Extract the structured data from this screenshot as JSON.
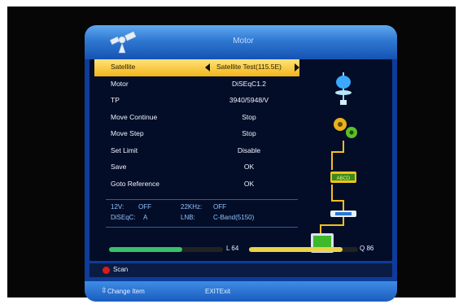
{
  "header": {
    "title": "Motor"
  },
  "menu": {
    "items": [
      {
        "label": "Satellite",
        "value": "Satellite Test(115.5E)",
        "selected": true
      },
      {
        "label": "Motor",
        "value": "DiSEqC1.2"
      },
      {
        "label": "TP",
        "value": "3940/5948/V"
      },
      {
        "label": "Move Continue",
        "value": "Stop"
      },
      {
        "label": "Move Step",
        "value": "Stop"
      },
      {
        "label": "Set Limit",
        "value": "Disable"
      },
      {
        "label": "Save",
        "value": "OK"
      },
      {
        "label": "Goto Reference",
        "value": "OK"
      }
    ]
  },
  "info": {
    "v12_label": "12V:",
    "v12_value": "OFF",
    "k22_label": "22KHz:",
    "k22_value": "OFF",
    "diseqc_label": "DiSEqC:",
    "diseqc_value": "A",
    "lnb_label": "LNB:",
    "lnb_value": "C-Band(5150)"
  },
  "signal": {
    "level_label": "L 64",
    "level": 0.64,
    "quality_label": "Q 86",
    "quality": 0.86
  },
  "scan": {
    "label": "Scan"
  },
  "footer": {
    "change_item": "Change Item",
    "exit": "EXITExit"
  },
  "diagram": {
    "switch_text": "ABCD"
  },
  "colors": {
    "selected_row": "#f2b51a",
    "level_bar": "#39c06a",
    "quality_bar": "#e9d34a",
    "scan_button": "#d81b1b"
  }
}
